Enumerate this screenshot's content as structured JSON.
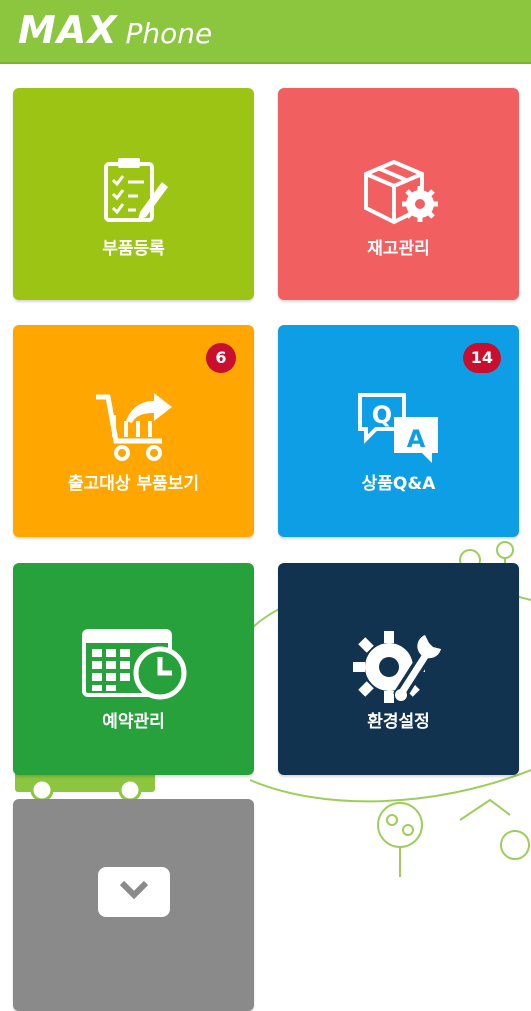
{
  "app": {
    "logo_main": "MAX",
    "logo_sub": "Phone"
  },
  "tiles": [
    {
      "label": "부품등록",
      "color": "#9cc414",
      "icon": "clipboard-checklist-icon"
    },
    {
      "label": "재고관리",
      "color": "#f25f61",
      "icon": "box-gear-icon"
    },
    {
      "label": "출고대상 부품보기",
      "color": "#ffa600",
      "icon": "cart-export-icon",
      "badge": "6"
    },
    {
      "label": "상품Q&A",
      "color": "#0d9ee6",
      "icon": "qa-bubbles-icon",
      "badge": "14"
    },
    {
      "label": "예약관리",
      "color": "#26a13c",
      "icon": "calendar-clock-icon"
    },
    {
      "label": "환경설정",
      "color": "#12334f",
      "icon": "gear-wrench-icon"
    },
    {
      "label": "",
      "color": "#8a8a8a",
      "icon": "chevron-down-icon"
    }
  ],
  "colors": {
    "header": "#8cc63f",
    "badge": "#c8102e"
  }
}
